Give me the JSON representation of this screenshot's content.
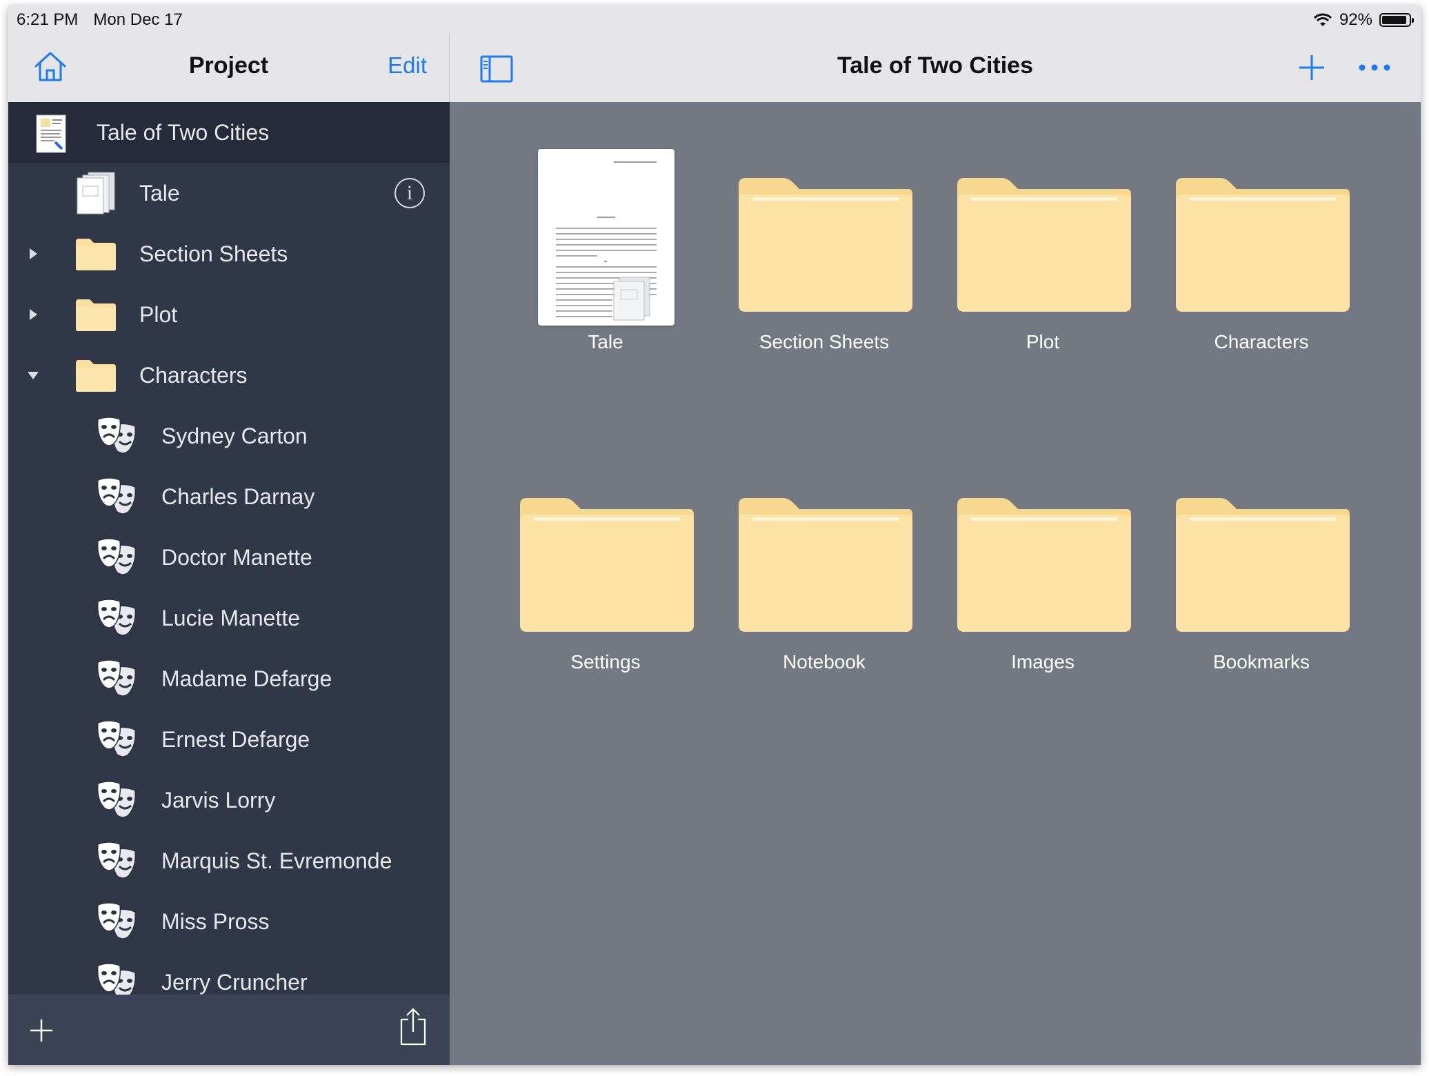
{
  "status_bar": {
    "time": "6:21 PM",
    "date": "Mon Dec 17",
    "battery": "92%",
    "battery_level": 0.92
  },
  "sidebar": {
    "title": "Project",
    "edit_label": "Edit",
    "root": {
      "label": "Tale of Two Cities"
    },
    "items": [
      {
        "label": "Tale",
        "icon": "document-stack-icon"
      },
      {
        "label": "Section Sheets",
        "icon": "folder-icon",
        "disclosure": "collapsed"
      },
      {
        "label": "Plot",
        "icon": "folder-icon",
        "disclosure": "collapsed"
      },
      {
        "label": "Characters",
        "icon": "folder-icon",
        "disclosure": "expanded"
      }
    ],
    "characters": [
      "Sydney Carton",
      "Charles Darnay",
      "Doctor Manette",
      "Lucie Manette",
      "Madame Defarge",
      "Ernest Defarge",
      "Jarvis Lorry",
      "Marquis St. Evremonde",
      "Miss Pross",
      "Jerry Cruncher"
    ]
  },
  "detail": {
    "title": "Tale of Two Cities",
    "tiles": [
      {
        "label": "Tale",
        "kind": "document"
      },
      {
        "label": "Section Sheets",
        "kind": "folder"
      },
      {
        "label": "Plot",
        "kind": "folder"
      },
      {
        "label": "Characters",
        "kind": "folder"
      },
      {
        "label": "Settings",
        "kind": "folder"
      },
      {
        "label": "Notebook",
        "kind": "folder"
      },
      {
        "label": "Images",
        "kind": "folder"
      },
      {
        "label": "Bookmarks",
        "kind": "folder"
      }
    ]
  },
  "colors": {
    "accent": "#1a7cf2",
    "sidebar_bg": "#303848",
    "detail_bg": "#737882",
    "folder": "#fbe0a0"
  }
}
